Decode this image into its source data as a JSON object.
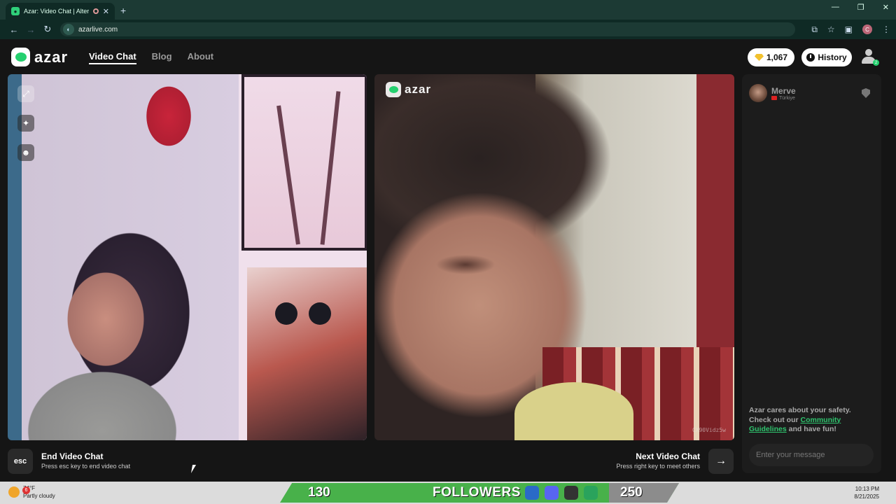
{
  "browser": {
    "tab_title": "Azar: Video Chat | Alternati",
    "url": "azarlive.com",
    "profile_initial": "C"
  },
  "header": {
    "logo_text": "azar",
    "nav": [
      {
        "label": "Video Chat",
        "active": true
      },
      {
        "label": "Blog",
        "active": false
      },
      {
        "label": "About",
        "active": false
      }
    ],
    "gems": "1,067",
    "history_label": "History",
    "avatar_badge": "2"
  },
  "remote_video": {
    "logo_text": "azar",
    "watermark": "CX90Vidz5w"
  },
  "chat": {
    "peer_name": "Merve",
    "peer_country": "Türkiye",
    "safety_text_1": "Azar cares about your safety. Check out our ",
    "safety_link": "Community Guidelines",
    "safety_text_2": " and have fun!",
    "message_placeholder": "Enter your message"
  },
  "controls": {
    "esc_key": "esc",
    "end_title": "End Video Chat",
    "end_sub": "Press esc key to end video chat",
    "next_title": "Next Video Chat",
    "next_sub": "Press right key to meet others",
    "next_icon": "arrow-right-icon"
  },
  "taskbar": {
    "weather_badge": "6",
    "temp": "74°F",
    "condition": "Partly cloudy",
    "followers_start": "130",
    "followers_label": "FOLLOWERS",
    "followers_goal": "250",
    "time": "10:13 PM",
    "date": "8/21/2025"
  },
  "colors": {
    "brand_green": "#25d06f",
    "chrome_dark": "#0f2a25",
    "page_bg": "#151515"
  }
}
